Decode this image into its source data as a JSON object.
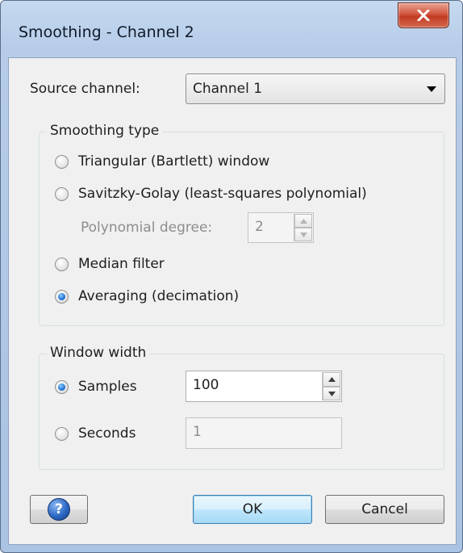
{
  "window": {
    "title": "Smoothing - Channel 2",
    "close_icon": "close-x-icon"
  },
  "source": {
    "label": "Source channel:",
    "selected": "Channel 1"
  },
  "smoothing_type": {
    "title": "Smoothing type",
    "options": [
      {
        "label": "Triangular (Bartlett) window",
        "checked": false
      },
      {
        "label": "Savitzky-Golay (least-squares polynomial)",
        "checked": false
      },
      {
        "label": "Median filter",
        "checked": false
      },
      {
        "label": "Averaging (decimation)",
        "checked": true
      }
    ],
    "polynomial_degree": {
      "label": "Polynomial degree:",
      "value": "2",
      "enabled": false
    }
  },
  "window_width": {
    "title": "Window width",
    "samples": {
      "label": "Samples",
      "checked": true,
      "value": "100"
    },
    "seconds": {
      "label": "Seconds",
      "checked": false,
      "value": "1"
    }
  },
  "buttons": {
    "help_icon": "help-question-icon",
    "help_glyph": "?",
    "ok": "OK",
    "cancel": "Cancel"
  },
  "colors": {
    "title_bar": "#b6cce8",
    "close_button": "#c23a22",
    "default_button": "#bee6fd",
    "radio_checked": "#2a7ad8"
  }
}
